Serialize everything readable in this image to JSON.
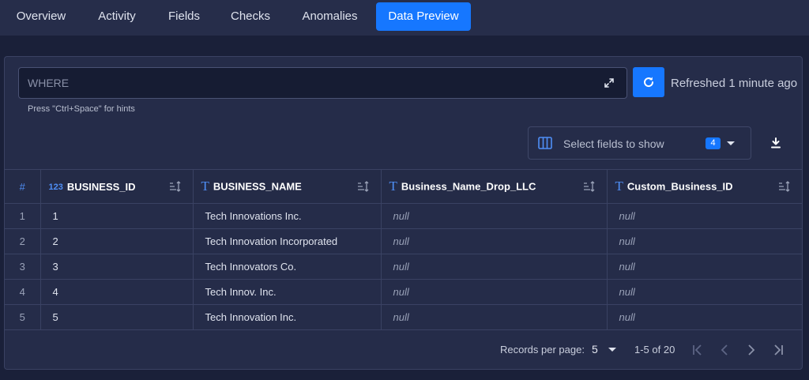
{
  "tabs": [
    {
      "label": "Overview",
      "active": false
    },
    {
      "label": "Activity",
      "active": false
    },
    {
      "label": "Fields",
      "active": false
    },
    {
      "label": "Checks",
      "active": false
    },
    {
      "label": "Anomalies",
      "active": false
    },
    {
      "label": "Data Preview",
      "active": true
    }
  ],
  "filter": {
    "placeholder": "WHERE",
    "value": "",
    "hint": "Press \"Ctrl+Space\" for hints",
    "expand_icon": "expand-icon"
  },
  "refresh": {
    "icon": "refresh-icon",
    "status": "Refreshed 1 minute ago"
  },
  "field_selector": {
    "icon": "columns-icon",
    "label": "Select fields to show",
    "count": "4"
  },
  "download_icon": "download-icon",
  "table": {
    "index_header": "#",
    "columns": [
      {
        "type_icon": "123",
        "type_name": "integer-type-icon",
        "label": "BUSINESS_ID"
      },
      {
        "type_icon": "T",
        "type_name": "string-type-icon",
        "label": "BUSINESS_NAME"
      },
      {
        "type_icon": "T",
        "type_name": "computed-string-type-icon",
        "label": "Business_Name_Drop_LLC"
      },
      {
        "type_icon": "T",
        "type_name": "computed-string-type-icon",
        "label": "Custom_Business_ID"
      }
    ],
    "rows": [
      {
        "index": "1",
        "cells": [
          "1",
          "Tech Innovations Inc.",
          "null",
          "null"
        ]
      },
      {
        "index": "2",
        "cells": [
          "2",
          "Tech Innovation Incorporated",
          "null",
          "null"
        ]
      },
      {
        "index": "3",
        "cells": [
          "3",
          "Tech Innovators Co.",
          "null",
          "null"
        ]
      },
      {
        "index": "4",
        "cells": [
          "4",
          "Tech Innov. Inc.",
          "null",
          "null"
        ]
      },
      {
        "index": "5",
        "cells": [
          "5",
          "Tech Innovation Inc.",
          "null",
          "null"
        ]
      }
    ]
  },
  "pagination": {
    "records_per_page_label": "Records per page:",
    "records_per_page": "5",
    "range": "1-5 of 20",
    "controls": [
      "first-page-icon",
      "previous-page-icon",
      "next-page-icon",
      "last-page-icon"
    ]
  },
  "colors": {
    "background": "#1a2039",
    "panel": "#252c49",
    "accent": "#1677ff"
  }
}
